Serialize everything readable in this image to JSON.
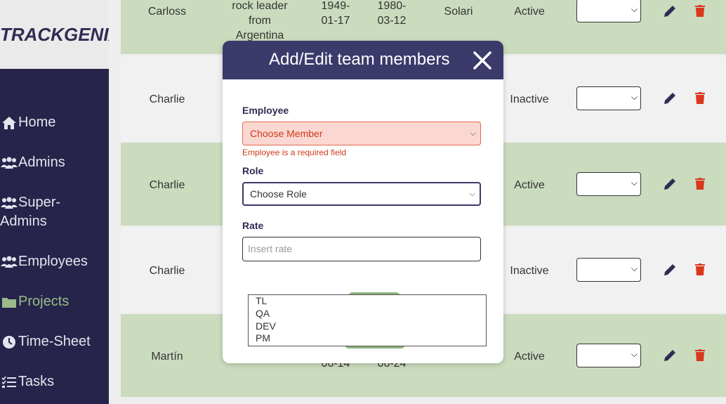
{
  "sidebar": {
    "logo": "TRACKGENIX",
    "items": [
      {
        "label": "Home",
        "icon": "home-icon",
        "active": false
      },
      {
        "label": "Admins",
        "icon": "users-icon",
        "active": false
      },
      {
        "label": "Super-Admins",
        "label_lines": [
          "Super-",
          "Admins"
        ],
        "icon": "users-icon",
        "active": false
      },
      {
        "label": "Employees",
        "icon": "users-icon",
        "active": false
      },
      {
        "label": "Projects",
        "icon": "folder-icon",
        "active": true
      },
      {
        "label": "Time-Sheet",
        "icon": "clock-icon",
        "active": false
      },
      {
        "label": "Tasks",
        "icon": "tasks-icon",
        "active": false
      }
    ]
  },
  "table": {
    "rows": [
      {
        "name": "Carloss",
        "description_lines": [
          "rock leader",
          "from",
          "Argentina"
        ],
        "start_lines": [
          "1949-",
          "01-17"
        ],
        "end_lines": [
          "1980-",
          "03-12"
        ],
        "client": "Solari",
        "status": "Active"
      },
      {
        "name": "Charlie",
        "description_lines": [],
        "start_lines": [],
        "end_lines": [],
        "client": "",
        "status": "Inactive"
      },
      {
        "name": "Charlie",
        "description_lines": [],
        "start_lines": [],
        "end_lines": [],
        "client": "",
        "status": "Active"
      },
      {
        "name": "Charlie",
        "description_lines": [],
        "start_lines": [],
        "end_lines": [],
        "client": "",
        "status": "Inactive"
      },
      {
        "name": "Martín",
        "description_lines": [],
        "start_lines": [
          "06-14"
        ],
        "end_lines": [
          "06-24"
        ],
        "client": "",
        "status": "Active"
      }
    ]
  },
  "modal": {
    "title": "Add/Edit team members",
    "employee": {
      "label": "Employee",
      "value": "Choose Member",
      "error": "Employee is a required field"
    },
    "role": {
      "label": "Role",
      "value": "Choose Role",
      "options": [
        "TL",
        "QA",
        "DEV",
        "PM"
      ]
    },
    "rate": {
      "label": "Rate",
      "placeholder": "Insert rate"
    }
  },
  "colors": {
    "sidebar_bg": "#26244a",
    "modal_header": "#3b3a6b",
    "row_green": "#cbdcbe",
    "error_red": "#d03b1b",
    "accent_green": "#8db37b",
    "edit_blue": "#2f2d54",
    "delete_red": "#d9381e"
  }
}
